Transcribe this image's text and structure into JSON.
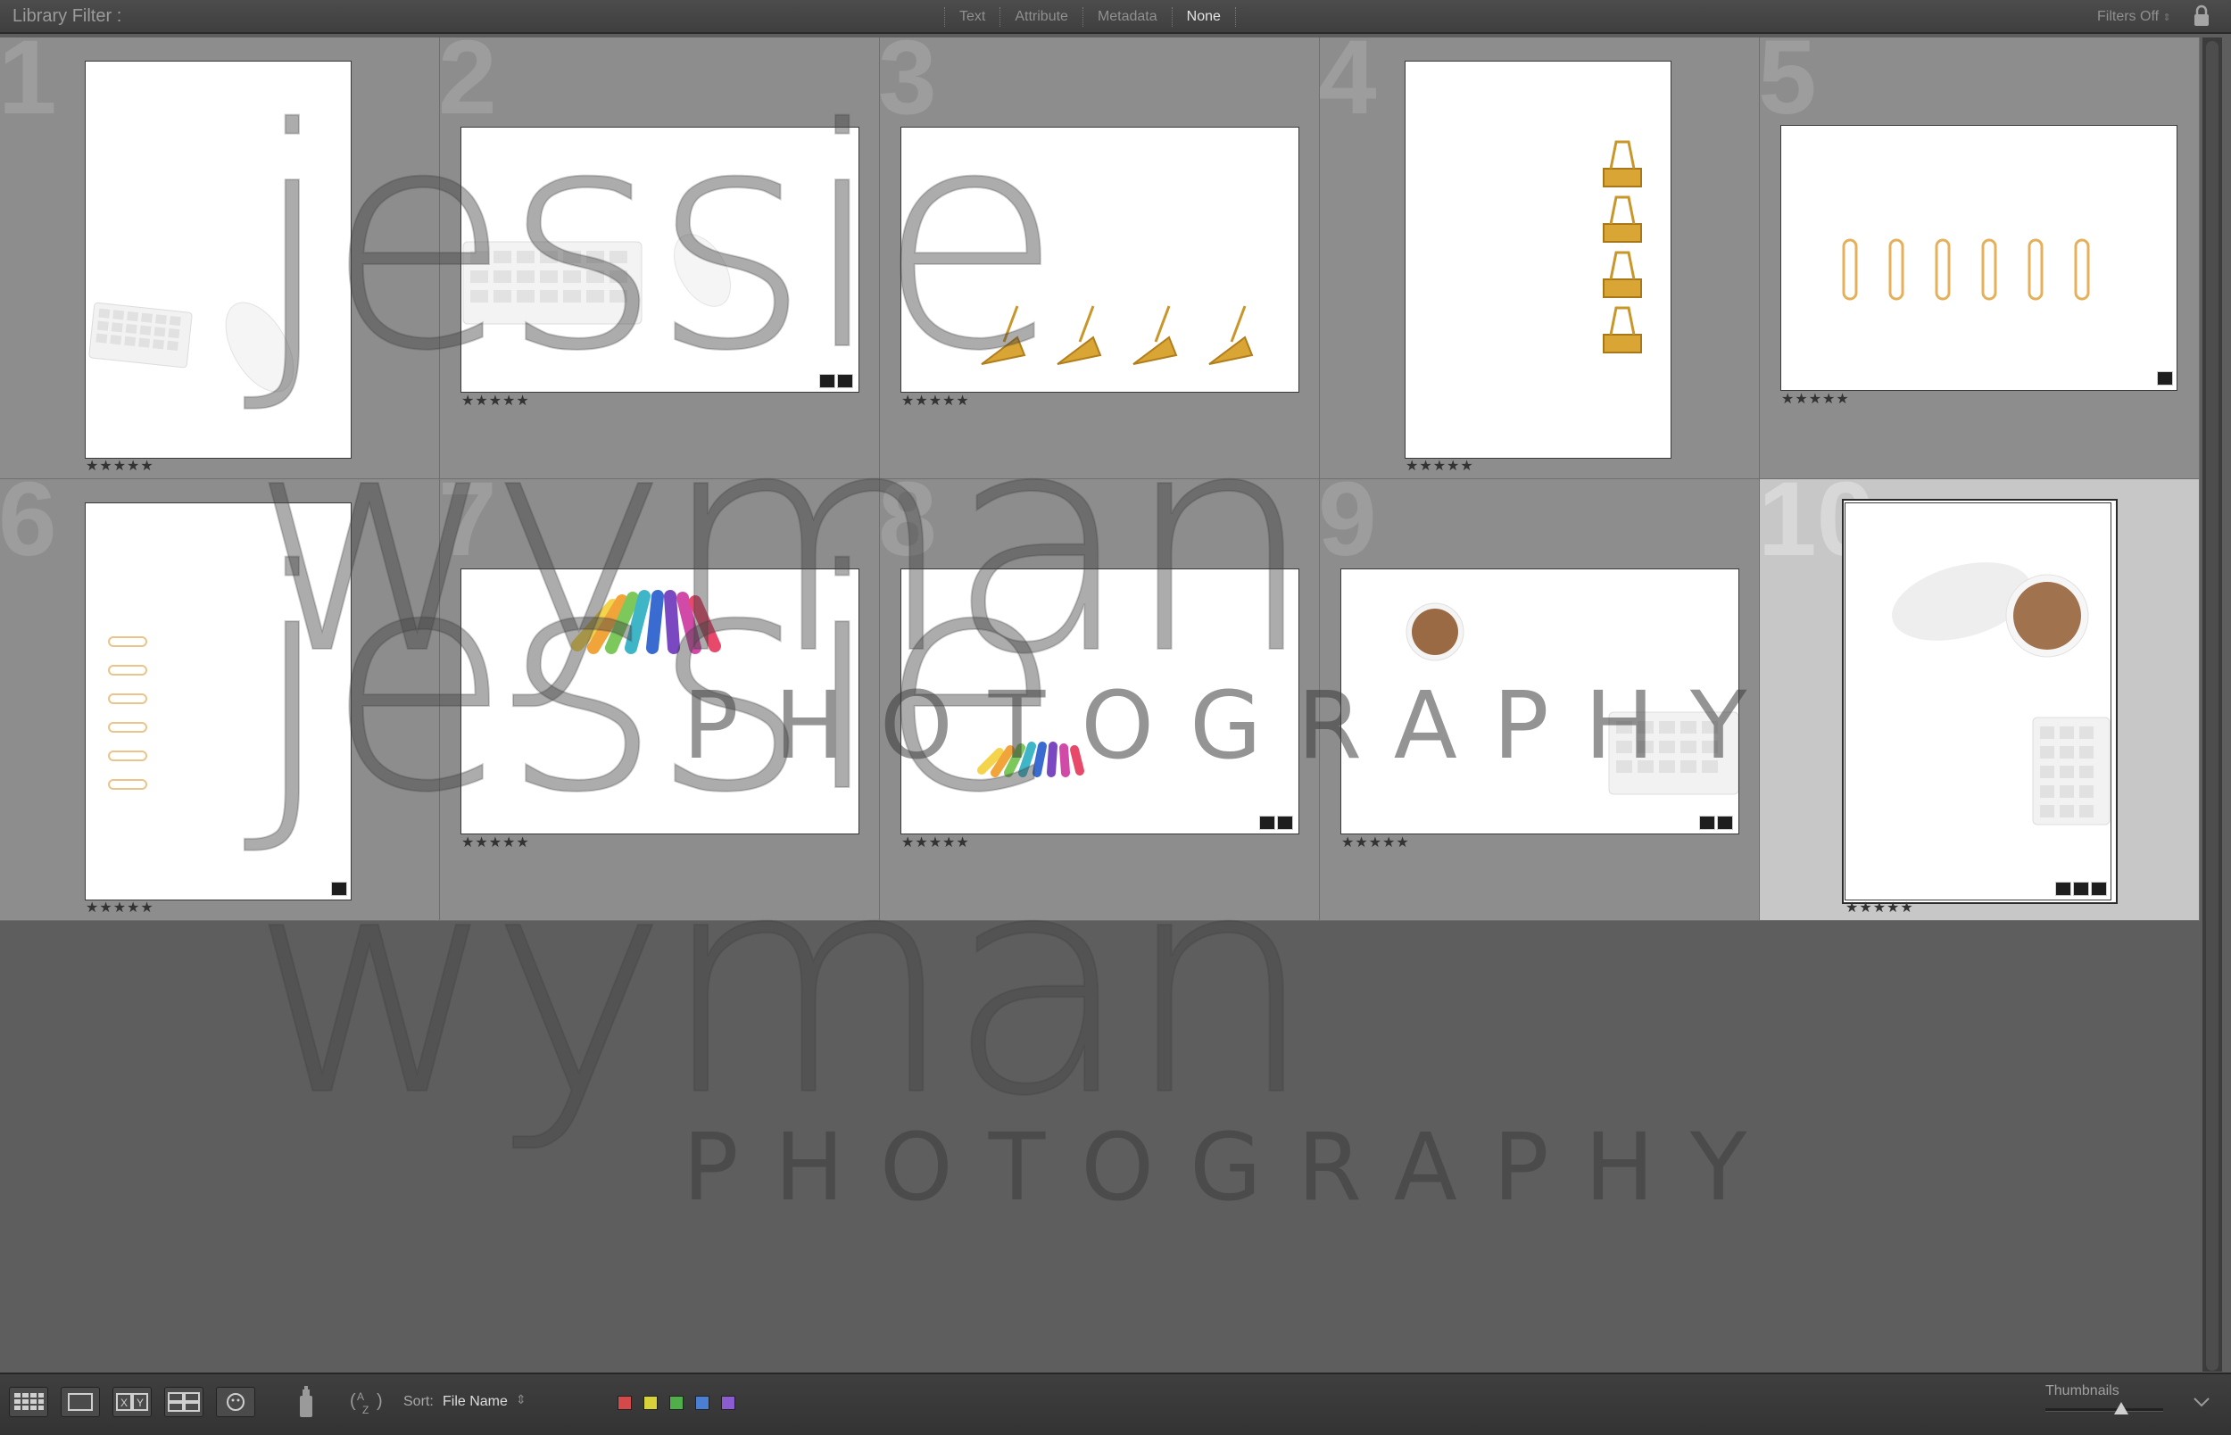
{
  "filter_bar": {
    "title": "Library Filter :",
    "tabs": [
      "Text",
      "Attribute",
      "Metadata",
      "None"
    ],
    "active_tab": "None",
    "filters_status": "Filters Off"
  },
  "grid": {
    "cells": [
      {
        "index": "1",
        "orientation": "portrait",
        "rating": "★★★★★",
        "subject": "keyboard and mouse",
        "selected": false
      },
      {
        "index": "2",
        "orientation": "landscape",
        "rating": "★★★★★",
        "subject": "keyboard and mouse",
        "selected": false
      },
      {
        "index": "3",
        "orientation": "landscape",
        "rating": "★★★★★",
        "subject": "gold binder clips in a row",
        "selected": false
      },
      {
        "index": "4",
        "orientation": "portrait",
        "rating": "★★★★★",
        "subject": "gold binder clips stacked",
        "selected": false
      },
      {
        "index": "5",
        "orientation": "landscape",
        "rating": "★★★★★",
        "subject": "gold paper clips",
        "selected": false
      },
      {
        "index": "6",
        "orientation": "portrait",
        "rating": "★★★★★",
        "subject": "gold paper clips vertical",
        "selected": false
      },
      {
        "index": "7",
        "orientation": "landscape",
        "rating": "★★★★★",
        "subject": "rainbow pens fan",
        "selected": false
      },
      {
        "index": "8",
        "orientation": "landscape",
        "rating": "★★★★★",
        "subject": "rainbow pens",
        "selected": false
      },
      {
        "index": "9",
        "orientation": "landscape",
        "rating": "★★★★★",
        "subject": "coffee cup and keyboard",
        "selected": false
      },
      {
        "index": "10",
        "orientation": "portrait",
        "rating": "★★★★★",
        "subject": "coffee cup and keyboard",
        "selected": true
      }
    ]
  },
  "watermark": {
    "script": "jessie wyman",
    "sub": "PHOTOGRAPHY"
  },
  "toolbar": {
    "view_buttons": [
      "grid-view",
      "loupe-view",
      "compare-view",
      "survey-view",
      "people-view"
    ],
    "painter_icon": "spray-can-icon",
    "sort_order_icon": "az-sort-icon",
    "sort_label": "Sort:",
    "sort_value": "File Name",
    "color_labels": [
      "#d44a4a",
      "#d8d23a",
      "#4fb04a",
      "#4b7fd4",
      "#8a5cd0"
    ],
    "thumbnails_label": "Thumbnails",
    "thumbnail_size": 0.45
  },
  "colors": {
    "background": "#5e5e5e",
    "cell": "#8d8d8d",
    "cell_selected": "#c7c7c7"
  }
}
